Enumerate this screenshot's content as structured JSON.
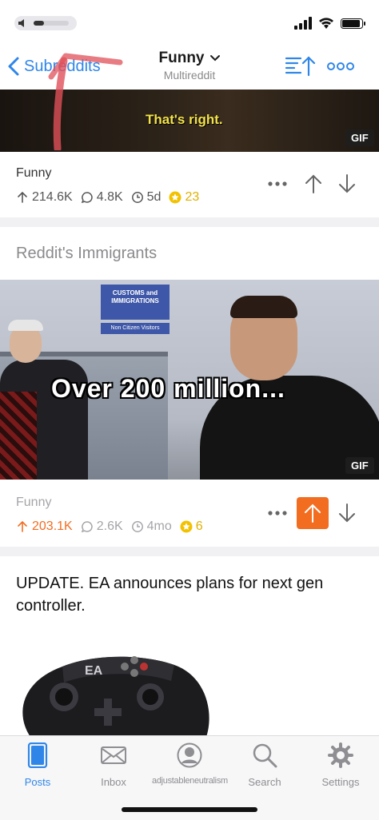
{
  "status": {
    "volume_level": 0.3
  },
  "nav": {
    "back_label": "Subreddits",
    "title": "Funny",
    "subtitle": "Multireddit"
  },
  "posts": [
    {
      "media_caption": "That's right.",
      "media_badge": "GIF",
      "subreddit": "Funny",
      "upvotes": "214.6K",
      "comments": "4.8K",
      "age": "5d",
      "awards": "23",
      "upvoted": false
    },
    {
      "title": "Reddit's Immigrants",
      "media_caption": "Over 200 million...",
      "media_badge": "GIF",
      "sign_text": "CUSTOMS and IMMIGRATIONS",
      "sign_sub": "Non Citizen Visitors",
      "subreddit": "Funny",
      "upvotes": "203.1K",
      "comments": "2.6K",
      "age": "4mo",
      "awards": "6",
      "upvoted": true
    },
    {
      "title": "UPDATE. EA announces plans for next gen controller.",
      "controller_logo": "EA"
    }
  ],
  "tabs": [
    {
      "label": "Posts",
      "icon": "posts-icon",
      "active": true
    },
    {
      "label": "Inbox",
      "icon": "inbox-icon",
      "active": false
    },
    {
      "label": "adjustableneutralism",
      "icon": "profile-icon",
      "active": false
    },
    {
      "label": "Search",
      "icon": "search-icon",
      "active": false
    },
    {
      "label": "Settings",
      "icon": "settings-icon",
      "active": false
    }
  ],
  "colors": {
    "accent": "#2f86e8",
    "upvote_active": "#f36d21",
    "award_gold": "#e0b000",
    "annotation": "#e0505a"
  }
}
